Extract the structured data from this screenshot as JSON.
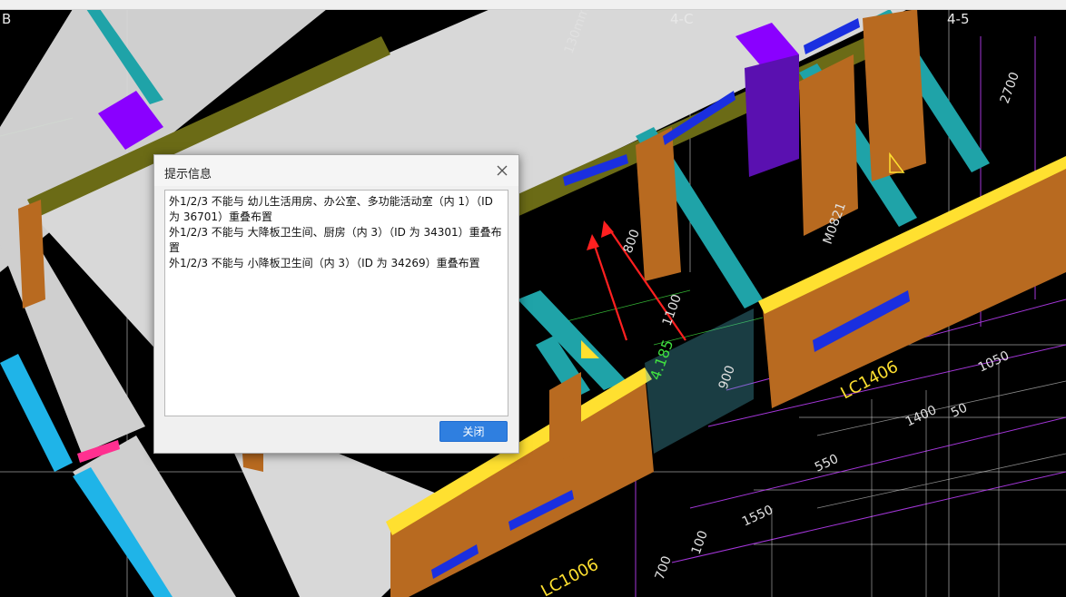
{
  "cad": {
    "axis_labels": [
      "B",
      "4-C",
      "4-5"
    ],
    "dims": [
      "1100",
      "900",
      "4.185",
      "800",
      "1400",
      "550",
      "1550",
      "1050",
      "50",
      "700",
      "100",
      "2700",
      "130mm"
    ],
    "window_tags": [
      "LC1406",
      "LC1006",
      "M0821"
    ]
  },
  "dialog": {
    "title": "提示信息",
    "messages": [
      "外1/2/3 不能与 幼儿生活用房、办公室、多功能活动室（内 1）（ID 为 36701）重叠布置",
      "外1/2/3 不能与 大降板卫生间、厨房（内 3）（ID 为 34301）重叠布置",
      "外1/2/3 不能与 小降板卫生间（内 3）（ID 为 34269）重叠布置"
    ],
    "close_button": "关闭"
  },
  "colors": {
    "cad_background": "#000000",
    "wall_orange": "#b86a20",
    "wall_yellow_top": "#ffe030",
    "slab_white": "#dcdcdc",
    "teal_beam": "#1fa3a8",
    "purple_column": "#8a00ff",
    "window_blue": "#1a2fe0",
    "primary_button": "#2f7fe0"
  }
}
